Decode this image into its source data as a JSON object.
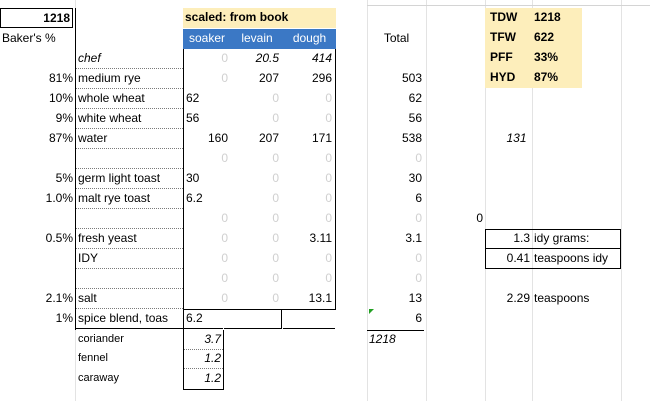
{
  "sheet": {
    "top_value": "1218",
    "scaled_label": "scaled: from book",
    "bakers_label": "Baker's %",
    "total_label": "Total",
    "headers": {
      "soaker": "soaker",
      "levain": "levain",
      "dough": "dough"
    },
    "summary": [
      {
        "label": "TDW",
        "value": "1218"
      },
      {
        "label": "TFW",
        "value": "622"
      },
      {
        "label": "PFF",
        "value": "33%"
      },
      {
        "label": "HYD",
        "value": "87%"
      }
    ],
    "rows": {
      "chef": {
        "pct": "",
        "label": "chef",
        "soaker": "0",
        "levain": "20.5",
        "dough": "414",
        "total": ""
      },
      "medium_rye": {
        "pct": "81%",
        "label": "medium rye",
        "soaker": "0",
        "levain": "207",
        "dough": "296",
        "total": "503"
      },
      "whole_wheat": {
        "pct": "10%",
        "label": "whole wheat",
        "soaker": "62",
        "levain": "0",
        "dough": "0",
        "total": "62"
      },
      "white_wheat": {
        "pct": "9%",
        "label": "white wheat",
        "soaker": "56",
        "levain": "0",
        "dough": "0",
        "total": "56"
      },
      "water": {
        "pct": "87%",
        "label": "water",
        "soaker": "160",
        "levain": "207",
        "dough": "171",
        "total": "538",
        "extra": "131"
      },
      "blank1": {
        "soaker": "0",
        "levain": "0",
        "dough": "0",
        "total": "0"
      },
      "germ": {
        "pct": "5%",
        "label": "germ light toast",
        "soaker": "30",
        "levain": "0",
        "dough": "0",
        "total": "30"
      },
      "malt": {
        "pct": "1.0%",
        "label": "malt rye toast",
        "soaker": "6.2",
        "levain": "0",
        "dough": "0",
        "total": "6"
      },
      "blank2": {
        "soaker": "0",
        "levain": "0",
        "dough": "0",
        "total": "0",
        "extra": "0"
      },
      "yeast": {
        "pct": "0.5%",
        "label": "fresh yeast",
        "soaker": "0",
        "levain": "0",
        "dough": "3.11",
        "total": "3.1",
        "idy_val": "1.3",
        "idy_label": "idy grams:"
      },
      "idy": {
        "pct": "",
        "label": "IDY",
        "soaker": "0",
        "levain": "0",
        "dough": "0",
        "total": "0",
        "idy_val": "0.41",
        "idy_label": "teaspoons idy"
      },
      "blank3": {
        "soaker": "0",
        "levain": "0",
        "dough": "0",
        "total": "0"
      },
      "salt": {
        "pct": "2.1%",
        "label": "salt",
        "soaker": "0",
        "levain": "0",
        "dough": "13.1",
        "total": "13",
        "tsp_val": "2.29",
        "tsp_label": "teaspoons"
      },
      "spice": {
        "pct": "1%",
        "label": "spice blend, toas",
        "soaker": "6.2",
        "total": "6"
      },
      "coriander": {
        "label": "coriander",
        "soaker": "3.7",
        "total": "1218"
      },
      "fennel": {
        "label": "fennel",
        "soaker": "1.2"
      },
      "caraway": {
        "label": "caraway",
        "soaker": "1.2"
      }
    }
  }
}
